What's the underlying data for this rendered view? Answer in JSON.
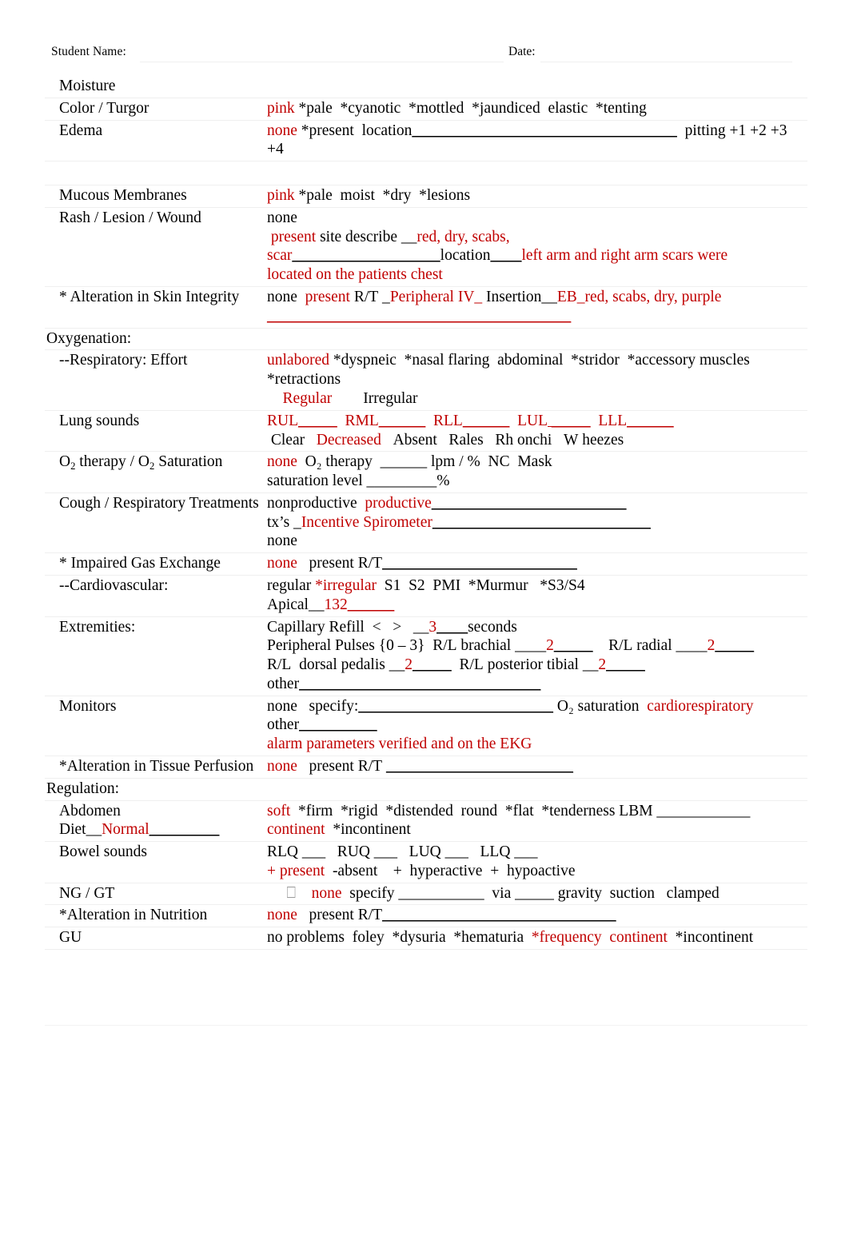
{
  "header": {
    "student_label": "Student Name:",
    "date_label": "Date:"
  },
  "rows": [
    {
      "id": "moisture",
      "label": "Moisture",
      "value_lines": []
    },
    {
      "id": "color-turgor",
      "label": "Color / Turgor",
      "value_lines": [
        [
          {
            "t": "pink",
            "c": "red"
          },
          {
            "t": " *pale  *cyanotic  *mottled  *jaundiced  elastic  *tenting",
            "c": "black"
          }
        ]
      ]
    },
    {
      "id": "edema",
      "label": "Edema",
      "value_lines": [
        [
          {
            "t": "none",
            "c": "red"
          },
          {
            "t": " *present  location",
            "c": "black"
          },
          {
            "t": "__________________________________",
            "c": "black",
            "rule": true
          },
          {
            "t": "  pitting +1 +2 +3",
            "c": "black"
          }
        ],
        [
          {
            "t": "+4",
            "c": "black"
          }
        ]
      ]
    },
    {
      "id": "mucous-membranes",
      "label": "Mucous Membranes",
      "value_lines": [
        [
          {
            "t": "pink",
            "c": "red"
          },
          {
            "t": " *pale  moist  *dry  *lesions",
            "c": "black"
          }
        ]
      ]
    },
    {
      "id": "rash-lesion-wound",
      "label": "Rash / Lesion / Wound",
      "value_lines": [
        [
          {
            "t": "none",
            "c": "black"
          }
        ],
        [
          {
            "t": " present",
            "c": "red"
          },
          {
            "t": " site describe __",
            "c": "black"
          },
          {
            "t": "red, dry, scabs,",
            "c": "red"
          }
        ],
        [
          {
            "t": "scar",
            "c": "red"
          },
          {
            "t": "___________________",
            "c": "black",
            "rule": true
          },
          {
            "t": "location",
            "c": "black"
          },
          {
            "t": "____",
            "c": "black",
            "rule": true
          },
          {
            "t": "left arm and right arm scars were",
            "c": "red"
          }
        ],
        [
          {
            "t": "located on the patients chest",
            "c": "red"
          }
        ]
      ]
    },
    {
      "id": "alteration-skin-integrity",
      "label": "* Alteration in Skin Integrity",
      "value_lines": [
        [
          {
            "t": "none  ",
            "c": "black"
          },
          {
            "t": "present",
            "c": "red"
          },
          {
            "t": " R/T _",
            "c": "black"
          },
          {
            "t": "Peripheral IV_",
            "c": "red"
          },
          {
            "t": " Insertion__",
            "c": "black"
          },
          {
            "t": "EB_red, scabs, dry, purple",
            "c": "red"
          }
        ],
        [
          {
            "t": "_______________________________________",
            "c": "red",
            "rule": true
          }
        ]
      ]
    },
    {
      "id": "oxygenation-section",
      "label": "Oxygenation:",
      "section": true,
      "value_lines": []
    },
    {
      "id": "respiratory-effort",
      "label": "--Respiratory:  Effort",
      "value_lines": [
        [
          {
            "t": "unlabored",
            "c": "red"
          },
          {
            "t": " *dyspneic  *nasal flaring  abdominal  *stridor  *accessory muscles",
            "c": "black"
          }
        ],
        [
          {
            "t": "*retractions",
            "c": "black"
          }
        ],
        [
          {
            "t": "    Regular",
            "c": "red"
          },
          {
            "t": "        Irregular",
            "c": "black"
          }
        ]
      ]
    },
    {
      "id": "lung-sounds",
      "label": "Lung sounds",
      "value_lines": [
        [
          {
            "t": "RUL",
            "c": "red"
          },
          {
            "t": "_____",
            "c": "red",
            "rule": true
          },
          {
            "t": "  RML",
            "c": "red"
          },
          {
            "t": "______",
            "c": "red",
            "rule": true
          },
          {
            "t": "  RLL",
            "c": "red"
          },
          {
            "t": "______",
            "c": "red",
            "rule": true
          },
          {
            "t": "  LUL",
            "c": "red"
          },
          {
            "t": " _____",
            "c": "red",
            "rule": true
          },
          {
            "t": "  LLL",
            "c": "red"
          },
          {
            "t": "______",
            "c": "red",
            "rule": true
          }
        ],
        [
          {
            "t": " Clear   ",
            "c": "black"
          },
          {
            "t": "Decreased",
            "c": "red"
          },
          {
            "t": "   Absent   Rales   Rh onchi   W heezes",
            "c": "black"
          }
        ]
      ]
    },
    {
      "id": "o2-therapy-saturation",
      "label": "O₂ therapy / O₂ Saturation",
      "label_html": "O<sub>2</sub> therapy / O<sub>2</sub> Saturation",
      "value_lines": [
        [
          {
            "t": "none",
            "c": "red"
          },
          {
            "t": "  O₂ therapy  ______ lpm / %  NC  Mask",
            "c": "black"
          }
        ],
        [
          {
            "t": "saturation level _________%",
            "c": "black"
          }
        ]
      ]
    },
    {
      "id": "cough-respiratory-treatments",
      "label": "Cough / Respiratory Treatments",
      "value_lines": [
        [
          {
            "t": "nonproductive  ",
            "c": "black"
          },
          {
            "t": "productive",
            "c": "red"
          },
          {
            "t": "_________________________",
            "c": "black",
            "rule": true
          }
        ],
        [
          {
            "t": "tx’s _",
            "c": "black"
          },
          {
            "t": "Incentive Spirometer",
            "c": "red"
          },
          {
            "t": "____________________________",
            "c": "black",
            "rule": true
          }
        ],
        [
          {
            "t": "none",
            "c": "black"
          }
        ]
      ]
    },
    {
      "id": "impaired-gas-exchange",
      "label": "* Impaired Gas Exchange",
      "value_lines": [
        [
          {
            "t": "none",
            "c": "red"
          },
          {
            "t": "   present R/T",
            "c": "black"
          },
          {
            "t": "_________________________",
            "c": "black",
            "rule": true
          }
        ]
      ]
    },
    {
      "id": "cardiovascular-section",
      "label": "--Cardiovascular:",
      "value_lines": [
        [
          {
            "t": "regular ",
            "c": "black"
          },
          {
            "t": "*irregular",
            "c": "red"
          },
          {
            "t": "  S1  S2  PMI  *Murmur   *S3/S4",
            "c": "black"
          }
        ],
        [
          {
            "t": "Apical__",
            "c": "black"
          },
          {
            "t": "132",
            "c": "red"
          },
          {
            "t": "______",
            "c": "red",
            "rule": true
          }
        ]
      ]
    },
    {
      "id": "extremities",
      "label": "Extremities:",
      "value_lines": [
        [
          {
            "t": "Capillary Refill  <   >   __",
            "c": "black"
          },
          {
            "t": "3",
            "c": "red"
          },
          {
            "t": "____",
            "c": "black",
            "rule": true
          },
          {
            "t": "seconds",
            "c": "black"
          }
        ],
        [
          {
            "t": "Peripheral Pulses {0 – 3}  R/L brachial ____",
            "c": "black"
          },
          {
            "t": "2",
            "c": "red"
          },
          {
            "t": "_____",
            "c": "black",
            "rule": true
          },
          {
            "t": "    R/L radial ____",
            "c": "black"
          },
          {
            "t": "2",
            "c": "red"
          },
          {
            "t": "_____",
            "c": "black",
            "rule": true
          }
        ],
        [
          {
            "t": "R/L  dorsal pedalis __",
            "c": "black"
          },
          {
            "t": "2",
            "c": "red"
          },
          {
            "t": "_____",
            "c": "black",
            "rule": true
          },
          {
            "t": "  R/L posterior tibial __",
            "c": "black"
          },
          {
            "t": "2",
            "c": "red"
          },
          {
            "t": "_____",
            "c": "black",
            "rule": true
          }
        ],
        [
          {
            "t": "other",
            "c": "black"
          },
          {
            "t": "_______________________________",
            "c": "black",
            "rule": true
          }
        ]
      ]
    },
    {
      "id": "monitors",
      "label": "Monitors",
      "value_lines": [
        [
          {
            "t": "none   specify:",
            "c": "black"
          },
          {
            "t": "_________________________",
            "c": "black",
            "rule": true
          },
          {
            "t": " O₂ saturation  ",
            "c": "black"
          },
          {
            "t": "cardiorespiratory",
            "c": "red"
          }
        ],
        [
          {
            "t": "other",
            "c": "black"
          },
          {
            "t": "__________",
            "c": "black",
            "rule": true
          }
        ],
        [
          {
            "t": "alarm parameters verified and on the EKG",
            "c": "red"
          }
        ]
      ]
    },
    {
      "id": "alteration-tissue-perfusion",
      "label": "*Alteration in Tissue Perfusion",
      "value_lines": [
        [
          {
            "t": "none",
            "c": "red"
          },
          {
            "t": "   present R/T ",
            "c": "black"
          },
          {
            "t": "________________________",
            "c": "black",
            "rule": true
          }
        ]
      ]
    },
    {
      "id": "regulation-section",
      "label": "Regulation:",
      "section": true,
      "value_lines": []
    },
    {
      "id": "abdomen",
      "label": "Abdomen",
      "label_line2_parts": [
        {
          "t": "Diet__",
          "c": "black"
        },
        {
          "t": "Normal",
          "c": "red"
        },
        {
          "t": "_________",
          "c": "black",
          "rule": true
        }
      ],
      "value_lines": [
        [
          {
            "t": "soft",
            "c": "red"
          },
          {
            "t": "  *firm  *rigid  *distended  round  *flat  *tenderness LBM ____________",
            "c": "black"
          }
        ],
        [
          {
            "t": "continent",
            "c": "red"
          },
          {
            "t": "  *incontinent",
            "c": "black"
          }
        ]
      ]
    },
    {
      "id": "bowel-sounds",
      "label": "Bowel sounds",
      "value_lines": [
        [
          {
            "t": "RLQ ___   RUQ ___   LUQ ___   LLQ ___",
            "c": "black"
          }
        ],
        [
          {
            "t": "+ present",
            "c": "red"
          },
          {
            "t": "  -absent    +  hyperactive  +  hypoactive",
            "c": "black"
          }
        ]
      ]
    },
    {
      "id": "ng-gt",
      "label": "NG / GT",
      "value_lines": [
        [
          {
            "t": "     ⎕    ",
            "c": "gray"
          },
          {
            "t": "none",
            "c": "red"
          },
          {
            "t": "  specify ___________  via _____ gravity  suction   clamped",
            "c": "black"
          }
        ]
      ]
    },
    {
      "id": "alteration-nutrition",
      "label": "*Alteration in Nutrition",
      "value_lines": [
        [
          {
            "t": "none",
            "c": "red"
          },
          {
            "t": "   present R/T",
            "c": "black"
          },
          {
            "t": "______________________________",
            "c": "black",
            "rule": true
          }
        ]
      ]
    },
    {
      "id": "gu",
      "label": "GU",
      "value_lines": [
        [
          {
            "t": "no problems  foley  *dysuria  *hematuria  ",
            "c": "black"
          },
          {
            "t": "*frequency  continent",
            "c": "red"
          },
          {
            "t": "  *incontinent",
            "c": "black"
          }
        ]
      ]
    }
  ],
  "footer": {
    "line1": "",
    "line2": "",
    "page_number": ""
  },
  "colors": {
    "entry_red": "#c00000",
    "text_black": "#000000",
    "rule_light": "#efefef"
  }
}
